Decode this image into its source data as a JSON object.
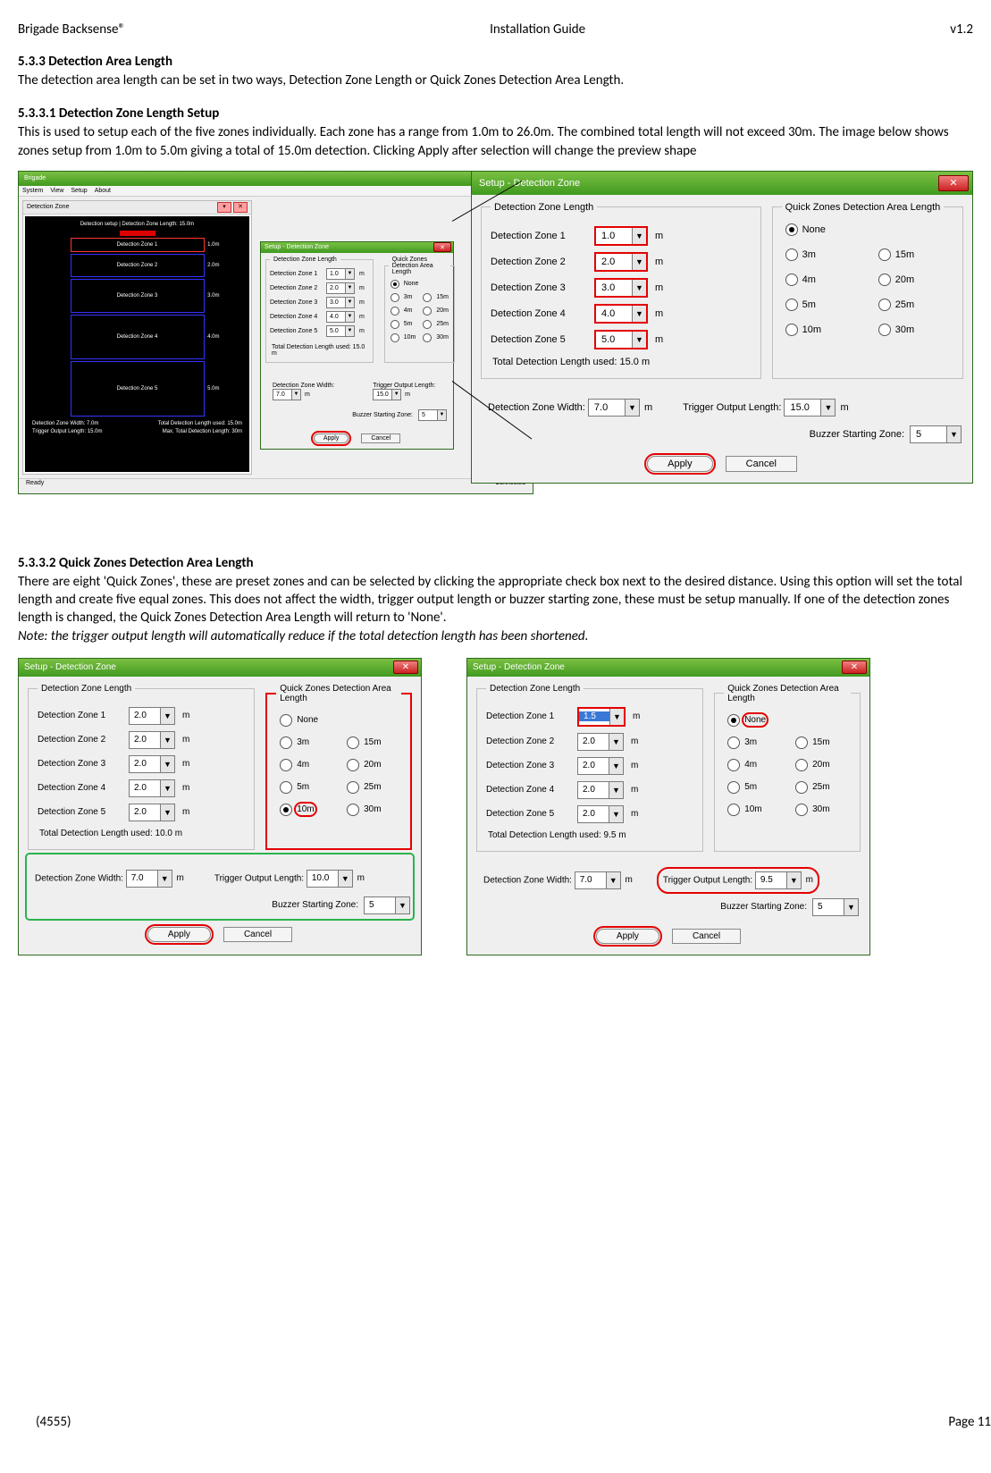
{
  "header": {
    "left": "Brigade Backsense®",
    "center": "Installation Guide",
    "right": "v1.2"
  },
  "footer": {
    "left": "(4555)",
    "right": "Page 11"
  },
  "s533": {
    "heading": "5.3.3 Detection Area Length",
    "text": "The detection area length can be set in two ways, Detection Zone Length or Quick Zones Detection Area Length."
  },
  "s5331": {
    "heading": "5.3.3.1 Detection Zone Length Setup",
    "text": "This is used to setup each of the five zones individually. Each zone has a range from 1.0m to 26.0m. The combined total length will not exceed 30m.  The image below shows zones setup from 1.0m to 5.0m giving a total of 15.0m detection. Clicking Apply after selection will change the preview shape"
  },
  "s5332": {
    "heading": "5.3.3.2 Quick Zones Detection Area Length",
    "text": "There are eight 'Quick Zones', these are preset zones and can be selected by clicking the appropriate check box next to the desired distance. Using this option will set the total length and create five equal zones. This does not affect the width, trigger output length or buzzer starting zone, these must be setup manually. If one of the detection zones length is changed, the Quick Zones Detection Area Length will return to 'None'.",
    "note": "Note: the trigger output length will automatically reduce if the total detection length has been shortened."
  },
  "dlg": {
    "title": "Setup - Detection Zone",
    "groupLen": "Detection Zone Length",
    "groupQuick": "Quick Zones Detection Area Length",
    "zones": [
      "Detection Zone 1",
      "Detection Zone 2",
      "Detection Zone 3",
      "Detection Zone 4",
      "Detection Zone 5"
    ],
    "totalLabel": "Total Detection Length used:",
    "widthLabel": "Detection Zone Width:",
    "triggerLabel": "Trigger Output Length:",
    "buzzerLabel": "Buzzer Starting Zone:",
    "apply": "Apply",
    "cancel": "Cancel",
    "quickOpts": [
      "None",
      "3m",
      "15m",
      "4m",
      "20m",
      "5m",
      "25m",
      "10m",
      "30m"
    ],
    "unit_m": "m"
  },
  "app": {
    "title": "Brigade",
    "menu": [
      "System",
      "View",
      "Setup",
      "About"
    ],
    "paneTitle": "Detection Zone",
    "topText": "Detection setup | Detection Zone Length: 15.0m",
    "zoneNames": [
      "Detection Zone 1",
      "Detection Zone 2",
      "Detection Zone 3",
      "Detection Zone 4",
      "Detection Zone 5"
    ],
    "zoneSide": [
      "1.0m",
      "2.0m",
      "3.0m",
      "4.0m",
      "5.0m"
    ],
    "info1a": "Detection Zone Width: 7.0m",
    "info1b": "Total Detection Length used: 15.0m",
    "info2a": "Trigger Output Length: 15.0m",
    "info2b": "Max. Total Detection Length: 30m",
    "statusLeft": "Ready",
    "statusRight": "Connected"
  },
  "dlgTiny": {
    "vals": [
      "1.0",
      "2.0",
      "3.0",
      "4.0",
      "5.0"
    ],
    "total": "15.0 m",
    "width": "7.0",
    "trigger": "15.0",
    "buzzer": "5",
    "quickSel": "None"
  },
  "dlgLarge": {
    "vals": [
      "1.0",
      "2.0",
      "3.0",
      "4.0",
      "5.0"
    ],
    "total": "15.0 m",
    "width": "7.0",
    "trigger": "15.0",
    "buzzer": "5",
    "quickSel": "None"
  },
  "dlgQ10": {
    "vals": [
      "2.0",
      "2.0",
      "2.0",
      "2.0",
      "2.0"
    ],
    "total": "10.0 m",
    "width": "7.0",
    "trigger": "10.0",
    "buzzer": "5",
    "quickSel": "10m"
  },
  "dlgQnone": {
    "vals": [
      "1.5",
      "2.0",
      "2.0",
      "2.0",
      "2.0"
    ],
    "total": "9.5 m",
    "width": "7.0",
    "trigger": "9.5",
    "buzzer": "5",
    "quickSel": "None"
  }
}
